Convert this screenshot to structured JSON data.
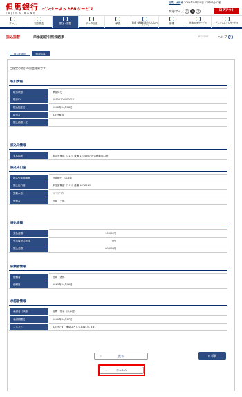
{
  "header": {
    "logo_text": "但馬銀行",
    "logo_sub": "TAJIMA BANK",
    "brand": "インターネットEBサービス",
    "user_name": "但馬　太郎",
    "user_suffix": "様 20XX年04月18日 12時07分22秒",
    "font_size_label": "文字サイズ",
    "font_sizes": [
      "小",
      "中",
      "大"
    ],
    "logout_label": "ログアウト"
  },
  "menu": [
    {
      "label": "ホーム",
      "icon": "home-icon"
    },
    {
      "label": "取引照会",
      "icon": "document-search-icon"
    },
    {
      "label": "振込・振替",
      "icon": "transfer-icon"
    },
    {
      "label": "データ伝送",
      "icon": "data-transfer-icon"
    },
    {
      "label": "承認",
      "icon": "approval-icon"
    },
    {
      "label": "税金・各種料金の払込み(ペイジー)",
      "icon": "pay-easy-icon"
    },
    {
      "label": "管理",
      "icon": "admin-icon"
    },
    {
      "label": "外為WEBサービス",
      "icon": "fx-icon"
    },
    {
      "label": "でんさいネットサービス",
      "icon": "densai-icon"
    }
  ],
  "page": {
    "section": "振込振替",
    "title": "未承認取引照会結果",
    "screen_id": "BTJS003",
    "help_label": "ヘルプ",
    "help_icon": "?"
  },
  "steps": [
    "取引を選択",
    "照会結果"
  ],
  "message": "ご指定の取引の照会結果です。",
  "sections": {
    "transaction": {
      "title": "取引情報",
      "rows": [
        [
          "取引状態",
          "承認待ち"
        ],
        [
          "取引ID",
          "101001000000111"
        ],
        [
          "振込指定日",
          "20XX年04月18日"
        ],
        [
          "取引名",
          "4月分家賃"
        ],
        [
          "振込依頼人名",
          "―"
        ]
      ]
    },
    "source": {
      "title": "振込元情報",
      "rows": [
        [
          "支払口座",
          "本店営業部（312）普通 1234567 資金移動用口座"
        ]
      ]
    },
    "destination": {
      "title": "振込先口座",
      "rows": [
        [
          "振込先金融機関",
          "但馬銀行（0164）"
        ],
        [
          "振込先口座",
          "本店営業部（312）普通 9876543"
        ],
        [
          "受取人名",
          "ﾀｼﾞﾏｻﾌﾞﾛｳ"
        ],
        [
          "登録名",
          "但馬　三郎"
        ]
      ]
    },
    "amount": {
      "title": "振込金額",
      "rows": [
        [
          "支払金額",
          "90,000円"
        ],
        [
          "先方負担手数料",
          "0円"
        ],
        [
          "振込金額",
          "90,000円"
        ]
      ]
    },
    "requester": {
      "title": "依頼者情報",
      "rows": [
        [
          "依頼者",
          "但馬　太郎"
        ],
        [
          "依頼日",
          "20XX年04月06日"
        ]
      ]
    },
    "approver": {
      "title": "承認者情報",
      "rows": [
        [
          "承認者（状態）",
          "但馬　花子（未承認）"
        ],
        [
          "承認期限日",
          "20XX年04月17日"
        ],
        [
          "コメント",
          "4月分です。確認よろしくお願いします。"
        ]
      ]
    }
  },
  "buttons": {
    "back": "戻る",
    "print": "印刷",
    "home": "ホームへ",
    "chevron": "‹",
    "print_icon": "⊖"
  }
}
